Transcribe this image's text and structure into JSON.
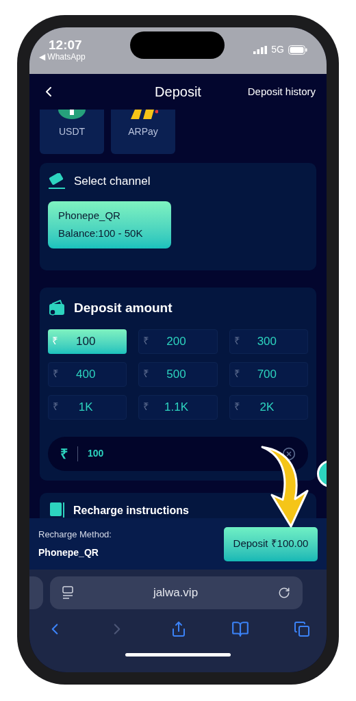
{
  "status_bar": {
    "time": "12:07",
    "back_app": "◀ WhatsApp",
    "network": "5G"
  },
  "header": {
    "title": "Deposit",
    "action": "Deposit history"
  },
  "payment_methods": [
    {
      "label": "USDT",
      "kind": "usdt"
    },
    {
      "label": "ARPay",
      "kind": "arpay"
    }
  ],
  "channel_section": {
    "title": "Select channel",
    "channels": [
      {
        "name": "Phonepe_QR",
        "balance": "Balance:100 - 50K",
        "selected": true
      }
    ]
  },
  "amount_section": {
    "title": "Deposit amount",
    "options": [
      {
        "currency": "₹",
        "amount": "100",
        "selected": true
      },
      {
        "currency": "₹",
        "amount": "200",
        "selected": false
      },
      {
        "currency": "₹",
        "amount": "300",
        "selected": false
      },
      {
        "currency": "₹",
        "amount": "400",
        "selected": false
      },
      {
        "currency": "₹",
        "amount": "500",
        "selected": false
      },
      {
        "currency": "₹",
        "amount": "700",
        "selected": false
      },
      {
        "currency": "₹",
        "amount": "1K",
        "selected": false
      },
      {
        "currency": "₹",
        "amount": "1.1K",
        "selected": false
      },
      {
        "currency": "₹",
        "amount": "2K",
        "selected": false
      }
    ],
    "input": {
      "currency": "₹",
      "value": "100"
    }
  },
  "instructions": {
    "title": "Recharge instructions"
  },
  "footer": {
    "method_label": "Recharge Method:",
    "method_value": "Phonepe_QR",
    "button": "Deposit ₹100.00"
  },
  "browser": {
    "url": "jalwa.vip"
  }
}
